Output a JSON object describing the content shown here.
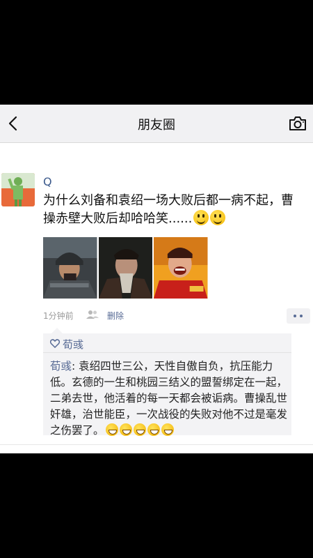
{
  "nav": {
    "title": "朋友圈",
    "back_icon": "chevron-left-icon",
    "camera_icon": "camera-icon"
  },
  "post": {
    "user_name": "Q",
    "text": "为什么刘备和袁绍一场大败后都一病不起，曹操赤壁大败后却哈哈笑......",
    "emojis": [
      "grin-emoji",
      "grin-emoji"
    ],
    "photos": [
      "armored-general-photo",
      "bearded-elder-photo",
      "laughing-warlord-photo"
    ],
    "time": "1分钟前",
    "delete_label": "删除"
  },
  "interactions": {
    "liker": "荀彧",
    "comment": {
      "author": "荀彧",
      "separator": ": ",
      "text": "袁绍四世三公，天性自傲自负，抗压能力低。玄德的一生和桃园三结义的盟誓绑定在一起，二弟去世，他活着的每一天都会被诟病。曹操乱世奸雄，治世能臣，一次战役的失败对他不过是毫发之伤罢了。",
      "emojis": [
        "laugh-cry-emoji",
        "laugh-cry-emoji",
        "grin-emoji",
        "grin-emoji",
        "grin-emoji"
      ]
    }
  },
  "colors": {
    "link": "#586b95",
    "name": "#3c5a8c",
    "navbar_bg": "#f1f1f3",
    "comment_bg": "#f3f3f5"
  }
}
